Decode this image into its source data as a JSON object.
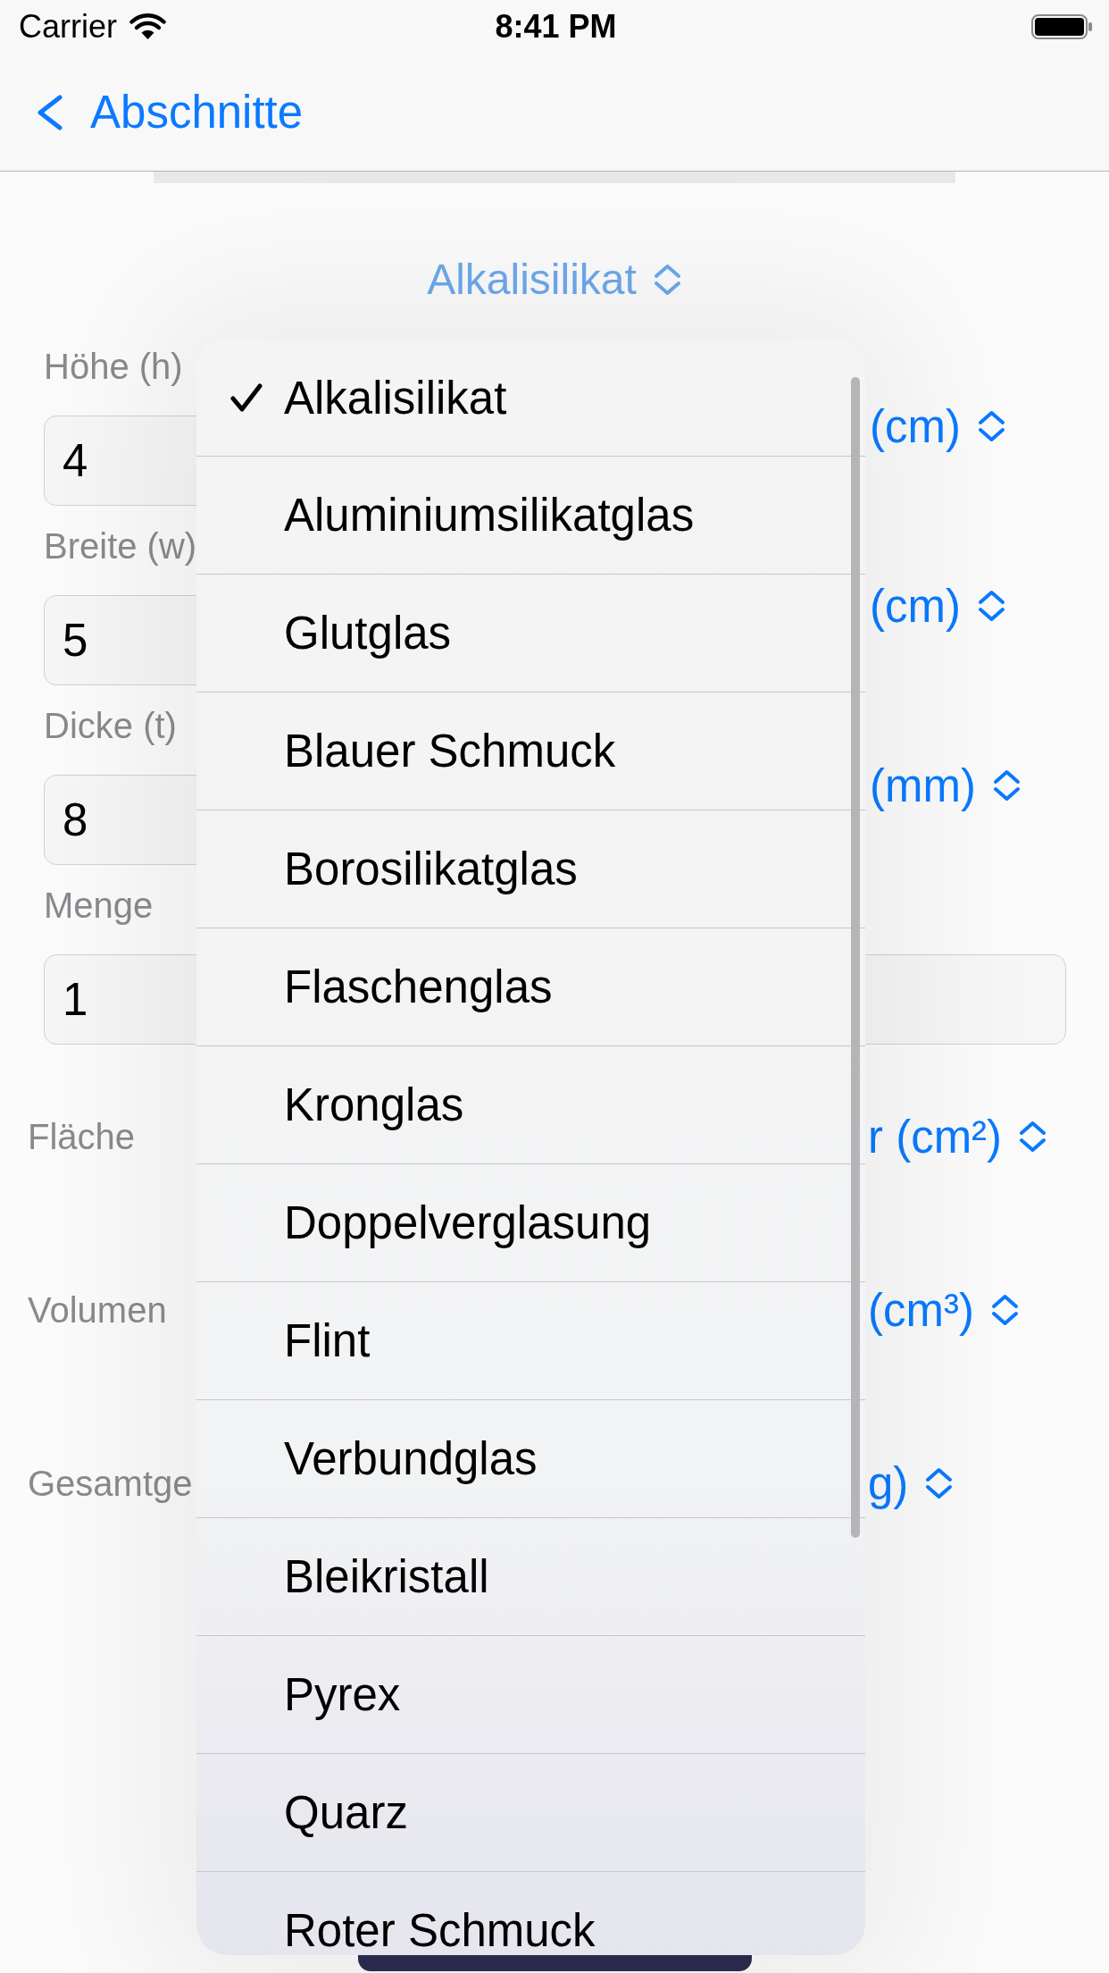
{
  "status_bar": {
    "carrier": "Carrier",
    "time": "8:41 PM"
  },
  "nav_bar": {
    "back_label": "Abschnitte"
  },
  "material_picker": {
    "value": "Alkalisilikat",
    "dimmed": true
  },
  "inputs": [
    {
      "label": "Höhe (h)",
      "value": "4",
      "unit": "(cm)"
    },
    {
      "label": "Breite (w)",
      "value": "5",
      "unit": "(cm)"
    },
    {
      "label": "Dicke (t)",
      "value": "8",
      "unit": "(mm)"
    },
    {
      "label": "Menge",
      "value": "1"
    }
  ],
  "results": [
    {
      "label": "Fläche",
      "unit": "r (cm²)"
    },
    {
      "label": "Volumen",
      "unit": "(cm³)"
    },
    {
      "label": "Gesamtge",
      "unit": "g)"
    }
  ],
  "menu": {
    "items": [
      {
        "label": "Alkalisilikat",
        "selected": true
      },
      {
        "label": "Aluminiumsilikatglas",
        "selected": false
      },
      {
        "label": "Glutglas",
        "selected": false
      },
      {
        "label": "Blauer Schmuck",
        "selected": false
      },
      {
        "label": "Borosilikatglas",
        "selected": false
      },
      {
        "label": "Flaschenglas",
        "selected": false
      },
      {
        "label": "Kronglas",
        "selected": false
      },
      {
        "label": "Doppelverglasung",
        "selected": false
      },
      {
        "label": "Flint",
        "selected": false
      },
      {
        "label": "Verbundglas",
        "selected": false
      },
      {
        "label": "Bleikristall",
        "selected": false
      },
      {
        "label": "Pyrex",
        "selected": false
      },
      {
        "label": "Quarz",
        "selected": false
      },
      {
        "label": "Roter Schmuck",
        "selected": false
      }
    ]
  }
}
